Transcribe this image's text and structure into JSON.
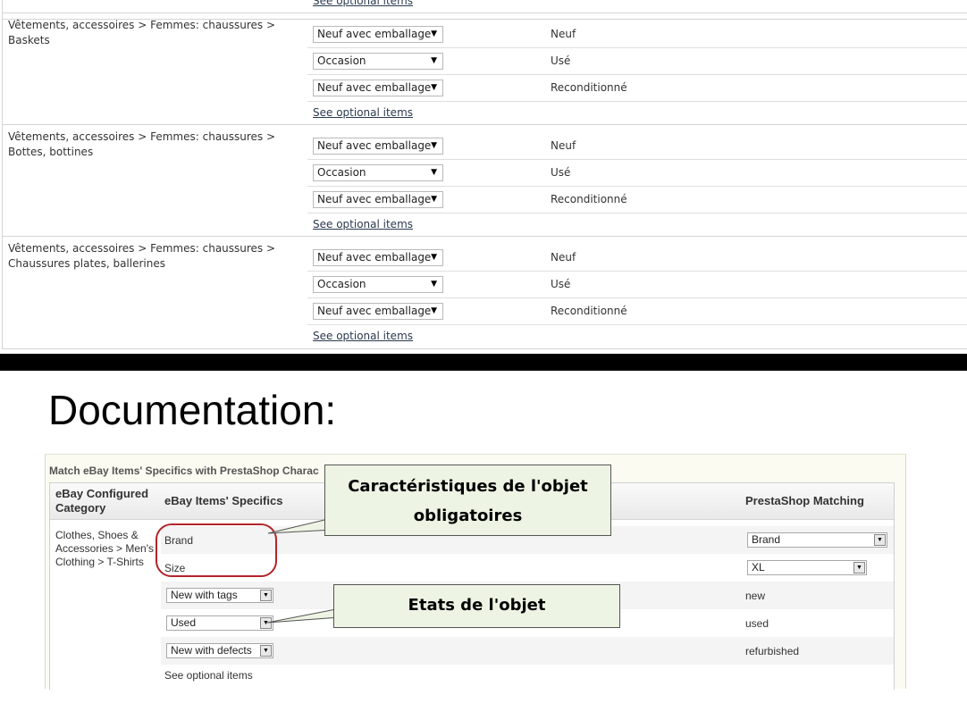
{
  "top_table": {
    "previous_link": "See optional items",
    "categories": [
      {
        "path": "Vêtements, accessoires > Femmes: chaussures > Baskets",
        "rows": [
          {
            "select": "Neuf avec emballage",
            "condition": "Neuf"
          },
          {
            "select": "Occasion",
            "condition": "Usé"
          },
          {
            "select": "Neuf avec emballage",
            "condition": "Reconditionné"
          }
        ],
        "link": "See optional items"
      },
      {
        "path": "Vêtements, accessoires > Femmes: chaussures > Bottes, bottines",
        "rows": [
          {
            "select": "Neuf avec emballage",
            "condition": "Neuf"
          },
          {
            "select": "Occasion",
            "condition": "Usé"
          },
          {
            "select": "Neuf avec emballage",
            "condition": "Reconditionné"
          }
        ],
        "link": "See optional items"
      },
      {
        "path": "Vêtements, accessoires > Femmes: chaussures > Chaussures plates, ballerines",
        "rows": [
          {
            "select": "Neuf avec emballage",
            "condition": "Neuf"
          },
          {
            "select": "Occasion",
            "condition": "Usé"
          },
          {
            "select": "Neuf avec emballage",
            "condition": "Reconditionné"
          }
        ],
        "link": "See optional items"
      }
    ],
    "dropdown_arrow": "▼"
  },
  "doc": {
    "title": "Documentation:",
    "screenshot": {
      "header": "Match eBay Items' Specifics with PrestaShop Charac",
      "col_category": "eBay Configured Category",
      "col_specifics": "eBay Items' Specifics",
      "col_matching": "PrestaShop Matching",
      "category_path": "Clothes, Shoes & Accessories > Men's Clothing > T-Shirts",
      "specifics": [
        {
          "name": "Brand",
          "match": "Brand"
        },
        {
          "name": "Size",
          "match": "XL"
        }
      ],
      "conditions": [
        {
          "select": "New with tags",
          "value": "new"
        },
        {
          "select": "Used",
          "value": "used"
        },
        {
          "select": "New with defects",
          "value": "refurbished"
        }
      ],
      "optional_link": "See optional items"
    },
    "callouts": {
      "mandatory_specifics": "Caractéristiques de l'objet obligatoires",
      "item_states": "Etats de l'objet"
    }
  }
}
